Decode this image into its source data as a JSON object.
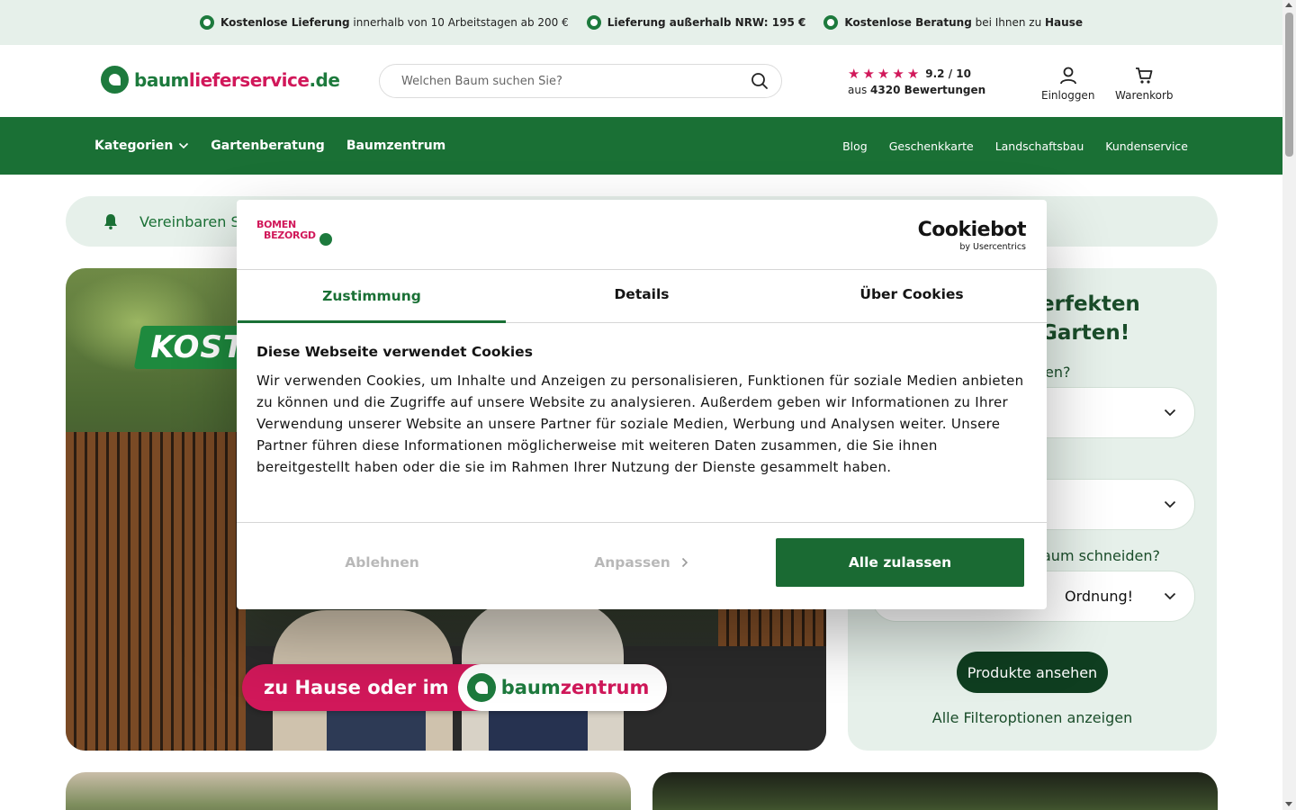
{
  "topbar": {
    "items": [
      {
        "bold": "Kostenlose Lieferung",
        "rest": " innerhalb von 10 Arbeitstagen ab 200 €"
      },
      {
        "bold": "Lieferung außerhalb NRW: 195 €",
        "rest": ""
      },
      {
        "bold": "Kostenlose Beratung",
        "rest": " bei Ihnen zu ",
        "bold2": "Hause"
      }
    ]
  },
  "header": {
    "brand": {
      "part1": "baum",
      "part2": "lieferservice",
      "part3": ".de"
    },
    "search_placeholder": "Welchen Baum suchen Sie?",
    "rating": {
      "score": "9.2 / 10",
      "prefix": "aus ",
      "count": "4320 Bewertungen",
      "stars": 4.5
    },
    "login_label": "Einloggen",
    "cart_label": "Warenkorb"
  },
  "nav": {
    "left": [
      "Kategorien",
      "Gartenberatung",
      "Baumzentrum"
    ],
    "right": [
      "Blog",
      "Geschenkkarte",
      "Landschaftsbau",
      "Kundenservice"
    ]
  },
  "notice": {
    "text": "Vereinbaren Si"
  },
  "hero": {
    "sticker": "KOST",
    "pill_text": "zu Hause oder im",
    "pill_brand_a": "baum",
    "pill_brand_b": "zentrum"
  },
  "panel": {
    "title_line1": "erfekten",
    "title_line2": "Garten!",
    "q1": "en?",
    "s1": "",
    "s2": "",
    "q3": "aum schneiden?",
    "s3": "Ordnung!",
    "button": "Produkte ansehen",
    "link": "Alle Filteroptionen anzeigen"
  },
  "cookie": {
    "partner_line1": "BOMEN",
    "partner_line2": "BEZORGD",
    "provider": "Cookiebot",
    "provider_sub": "by Usercentrics",
    "tabs": [
      "Zustimmung",
      "Details",
      "Über Cookies"
    ],
    "heading": "Diese Webseite verwendet Cookies",
    "body": "Wir verwenden Cookies, um Inhalte und Anzeigen zu personalisieren, Funktionen für soziale Medien anbieten zu können und die Zugriffe auf unsere Website zu analysieren. Außerdem geben wir Informationen zu Ihrer Verwendung unserer Website an unsere Partner für soziale Medien, Werbung und Analysen weiter. Unsere Partner führen diese Informationen möglicherweise mit weiteren Daten zusammen, die Sie ihnen bereitgestellt haben oder die sie im Rahmen Ihrer Nutzung der Dienste gesammelt haben.",
    "decline": "Ablehnen",
    "customize": "Anpassen",
    "accept": "Alle zulassen"
  },
  "colors": {
    "brand_green": "#1a7035",
    "brand_pink": "#d1185a",
    "light_green_bg": "#e6f0ea",
    "accept_button": "#1a6a33"
  }
}
